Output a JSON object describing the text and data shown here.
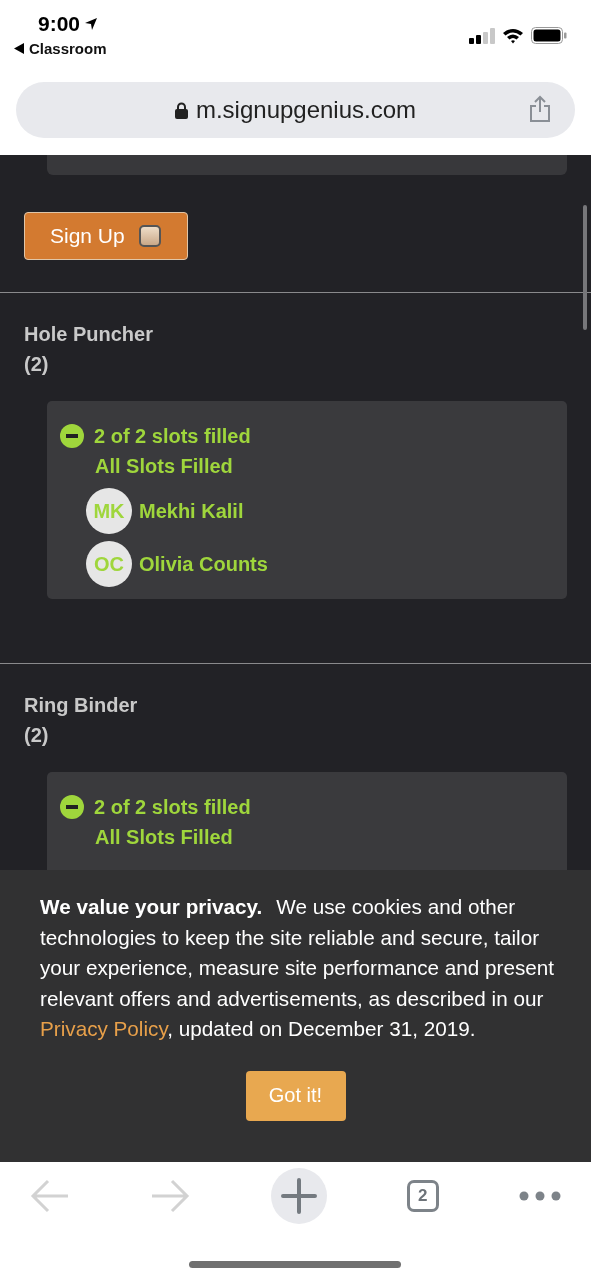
{
  "status_bar": {
    "time": "9:00",
    "back_app": "Classroom"
  },
  "url_bar": {
    "url": "m.signupgenius.com"
  },
  "signup_button": {
    "label": "Sign Up",
    "checked": false
  },
  "items": [
    {
      "title": "Hole Puncher",
      "count": "(2)",
      "summary": "2 of 2 slots filled",
      "status": "All Slots Filled",
      "slots": [
        {
          "initials": "MK",
          "name": "Mekhi Kalil"
        },
        {
          "initials": "OC",
          "name": "Olivia Counts"
        }
      ]
    },
    {
      "title": "Ring Binder",
      "count": "(2)",
      "summary": "2 of 2 slots filled",
      "status": "All Slots Filled"
    }
  ],
  "cookie_banner": {
    "lead": "We value your privacy.",
    "text": "We use cookies and other technologies to keep the site reliable and secure, tailor your experience, measure site performance and present relevant offers and advertisements, as described in our",
    "link": "Privacy Policy",
    "after": ", updated on December 31, 2019.",
    "button": "Got it!"
  },
  "toolbar": {
    "back_enabled": false,
    "forward_enabled": false,
    "tab_count": "2"
  }
}
